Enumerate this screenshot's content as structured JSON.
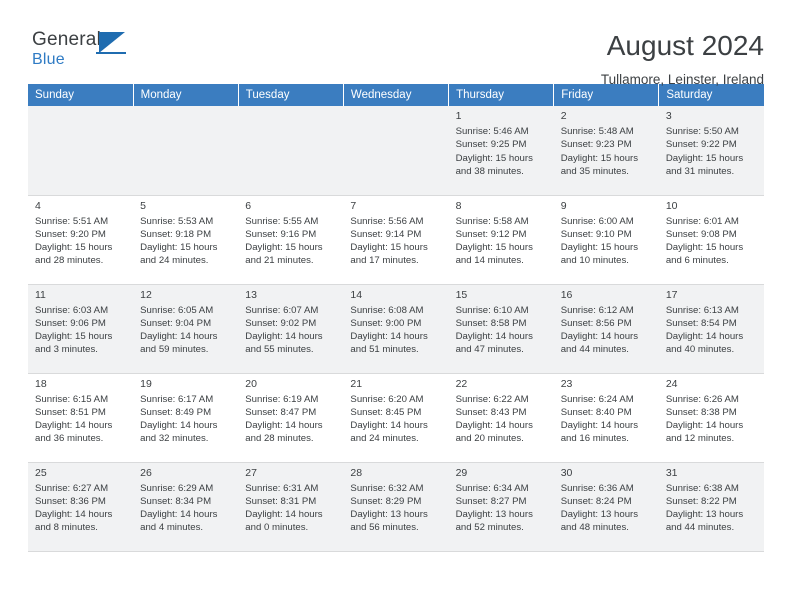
{
  "brand": {
    "line1": "General",
    "line2": "Blue",
    "flag_icon": "blue-flag-icon"
  },
  "header": {
    "title": "August 2024",
    "location": "Tullamore, Leinster, Ireland"
  },
  "calendar": {
    "weekday_headers": [
      "Sunday",
      "Monday",
      "Tuesday",
      "Wednesday",
      "Thursday",
      "Friday",
      "Saturday"
    ],
    "accent_color": "#3b7dc0",
    "shade_color": "#f1f2f3",
    "weeks": [
      [
        {
          "day": "",
          "lines": []
        },
        {
          "day": "",
          "lines": []
        },
        {
          "day": "",
          "lines": []
        },
        {
          "day": "",
          "lines": []
        },
        {
          "day": "1",
          "lines": [
            "Sunrise: 5:46 AM",
            "Sunset: 9:25 PM",
            "Daylight: 15 hours",
            "and 38 minutes."
          ]
        },
        {
          "day": "2",
          "lines": [
            "Sunrise: 5:48 AM",
            "Sunset: 9:23 PM",
            "Daylight: 15 hours",
            "and 35 minutes."
          ]
        },
        {
          "day": "3",
          "lines": [
            "Sunrise: 5:50 AM",
            "Sunset: 9:22 PM",
            "Daylight: 15 hours",
            "and 31 minutes."
          ]
        }
      ],
      [
        {
          "day": "4",
          "lines": [
            "Sunrise: 5:51 AM",
            "Sunset: 9:20 PM",
            "Daylight: 15 hours",
            "and 28 minutes."
          ]
        },
        {
          "day": "5",
          "lines": [
            "Sunrise: 5:53 AM",
            "Sunset: 9:18 PM",
            "Daylight: 15 hours",
            "and 24 minutes."
          ]
        },
        {
          "day": "6",
          "lines": [
            "Sunrise: 5:55 AM",
            "Sunset: 9:16 PM",
            "Daylight: 15 hours",
            "and 21 minutes."
          ]
        },
        {
          "day": "7",
          "lines": [
            "Sunrise: 5:56 AM",
            "Sunset: 9:14 PM",
            "Daylight: 15 hours",
            "and 17 minutes."
          ]
        },
        {
          "day": "8",
          "lines": [
            "Sunrise: 5:58 AM",
            "Sunset: 9:12 PM",
            "Daylight: 15 hours",
            "and 14 minutes."
          ]
        },
        {
          "day": "9",
          "lines": [
            "Sunrise: 6:00 AM",
            "Sunset: 9:10 PM",
            "Daylight: 15 hours",
            "and 10 minutes."
          ]
        },
        {
          "day": "10",
          "lines": [
            "Sunrise: 6:01 AM",
            "Sunset: 9:08 PM",
            "Daylight: 15 hours",
            "and 6 minutes."
          ]
        }
      ],
      [
        {
          "day": "11",
          "lines": [
            "Sunrise: 6:03 AM",
            "Sunset: 9:06 PM",
            "Daylight: 15 hours",
            "and 3 minutes."
          ]
        },
        {
          "day": "12",
          "lines": [
            "Sunrise: 6:05 AM",
            "Sunset: 9:04 PM",
            "Daylight: 14 hours",
            "and 59 minutes."
          ]
        },
        {
          "day": "13",
          "lines": [
            "Sunrise: 6:07 AM",
            "Sunset: 9:02 PM",
            "Daylight: 14 hours",
            "and 55 minutes."
          ]
        },
        {
          "day": "14",
          "lines": [
            "Sunrise: 6:08 AM",
            "Sunset: 9:00 PM",
            "Daylight: 14 hours",
            "and 51 minutes."
          ]
        },
        {
          "day": "15",
          "lines": [
            "Sunrise: 6:10 AM",
            "Sunset: 8:58 PM",
            "Daylight: 14 hours",
            "and 47 minutes."
          ]
        },
        {
          "day": "16",
          "lines": [
            "Sunrise: 6:12 AM",
            "Sunset: 8:56 PM",
            "Daylight: 14 hours",
            "and 44 minutes."
          ]
        },
        {
          "day": "17",
          "lines": [
            "Sunrise: 6:13 AM",
            "Sunset: 8:54 PM",
            "Daylight: 14 hours",
            "and 40 minutes."
          ]
        }
      ],
      [
        {
          "day": "18",
          "lines": [
            "Sunrise: 6:15 AM",
            "Sunset: 8:51 PM",
            "Daylight: 14 hours",
            "and 36 minutes."
          ]
        },
        {
          "day": "19",
          "lines": [
            "Sunrise: 6:17 AM",
            "Sunset: 8:49 PM",
            "Daylight: 14 hours",
            "and 32 minutes."
          ]
        },
        {
          "day": "20",
          "lines": [
            "Sunrise: 6:19 AM",
            "Sunset: 8:47 PM",
            "Daylight: 14 hours",
            "and 28 minutes."
          ]
        },
        {
          "day": "21",
          "lines": [
            "Sunrise: 6:20 AM",
            "Sunset: 8:45 PM",
            "Daylight: 14 hours",
            "and 24 minutes."
          ]
        },
        {
          "day": "22",
          "lines": [
            "Sunrise: 6:22 AM",
            "Sunset: 8:43 PM",
            "Daylight: 14 hours",
            "and 20 minutes."
          ]
        },
        {
          "day": "23",
          "lines": [
            "Sunrise: 6:24 AM",
            "Sunset: 8:40 PM",
            "Daylight: 14 hours",
            "and 16 minutes."
          ]
        },
        {
          "day": "24",
          "lines": [
            "Sunrise: 6:26 AM",
            "Sunset: 8:38 PM",
            "Daylight: 14 hours",
            "and 12 minutes."
          ]
        }
      ],
      [
        {
          "day": "25",
          "lines": [
            "Sunrise: 6:27 AM",
            "Sunset: 8:36 PM",
            "Daylight: 14 hours",
            "and 8 minutes."
          ]
        },
        {
          "day": "26",
          "lines": [
            "Sunrise: 6:29 AM",
            "Sunset: 8:34 PM",
            "Daylight: 14 hours",
            "and 4 minutes."
          ]
        },
        {
          "day": "27",
          "lines": [
            "Sunrise: 6:31 AM",
            "Sunset: 8:31 PM",
            "Daylight: 14 hours",
            "and 0 minutes."
          ]
        },
        {
          "day": "28",
          "lines": [
            "Sunrise: 6:32 AM",
            "Sunset: 8:29 PM",
            "Daylight: 13 hours",
            "and 56 minutes."
          ]
        },
        {
          "day": "29",
          "lines": [
            "Sunrise: 6:34 AM",
            "Sunset: 8:27 PM",
            "Daylight: 13 hours",
            "and 52 minutes."
          ]
        },
        {
          "day": "30",
          "lines": [
            "Sunrise: 6:36 AM",
            "Sunset: 8:24 PM",
            "Daylight: 13 hours",
            "and 48 minutes."
          ]
        },
        {
          "day": "31",
          "lines": [
            "Sunrise: 6:38 AM",
            "Sunset: 8:22 PM",
            "Daylight: 13 hours",
            "and 44 minutes."
          ]
        }
      ]
    ]
  }
}
